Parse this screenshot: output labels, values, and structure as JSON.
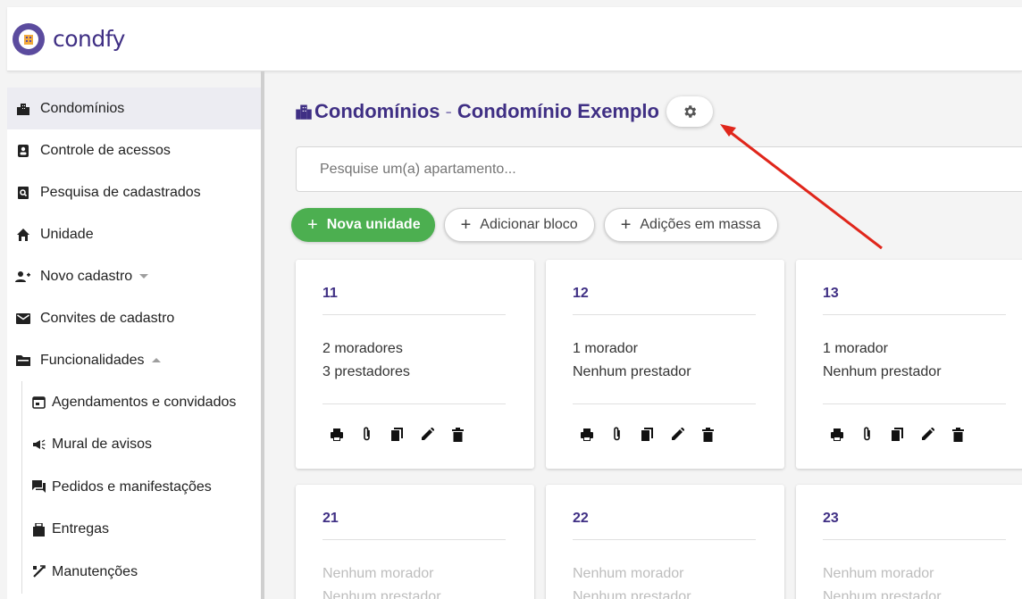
{
  "app": {
    "brand": "condfy",
    "brand_color": "#3f2f84",
    "accent_green": "#4caf50"
  },
  "sidebar": {
    "items": [
      {
        "label": "Condomínios",
        "icon": "building-icon",
        "active": true
      },
      {
        "label": "Controle de acessos",
        "icon": "badge-icon"
      },
      {
        "label": "Pesquisa de cadastrados",
        "icon": "search-doc-icon"
      },
      {
        "label": "Unidade",
        "icon": "home-icon"
      },
      {
        "label": "Novo cadastro",
        "icon": "add-user-icon",
        "caret": "down"
      },
      {
        "label": "Convites de cadastro",
        "icon": "mail-icon"
      },
      {
        "label": "Funcionalidades",
        "icon": "folder-icon",
        "caret": "up"
      }
    ],
    "subitems": [
      {
        "label": "Agendamentos e convidados",
        "icon": "calendar-icon"
      },
      {
        "label": "Mural de avisos",
        "icon": "megaphone-icon"
      },
      {
        "label": "Pedidos e manifestações",
        "icon": "chat-icon"
      },
      {
        "label": "Entregas",
        "icon": "package-icon"
      },
      {
        "label": "Manutenções",
        "icon": "tools-icon"
      }
    ]
  },
  "main": {
    "title": "Condomínios",
    "separator": "-",
    "subtitle": "Condomínio Exemplo",
    "search_placeholder": "Pesquise um(a) apartamento...",
    "buttons": {
      "new_unit": "Nova unidade",
      "add_block": "Adicionar bloco",
      "bulk_add": "Adições em massa"
    },
    "units": [
      {
        "number": "11",
        "residents": "2 moradores",
        "providers": "3 prestadores"
      },
      {
        "number": "12",
        "residents": "1 morador",
        "providers": "Nenhum prestador"
      },
      {
        "number": "13",
        "residents": "1 morador",
        "providers": "Nenhum prestador"
      },
      {
        "number": "21",
        "residents": "Nenhum morador",
        "providers": "Nenhum prestador"
      },
      {
        "number": "22",
        "residents": "Nenhum morador",
        "providers": "Nenhum prestador"
      },
      {
        "number": "23",
        "residents": "Nenhum morador",
        "providers": "Nenhum prestador"
      }
    ]
  }
}
